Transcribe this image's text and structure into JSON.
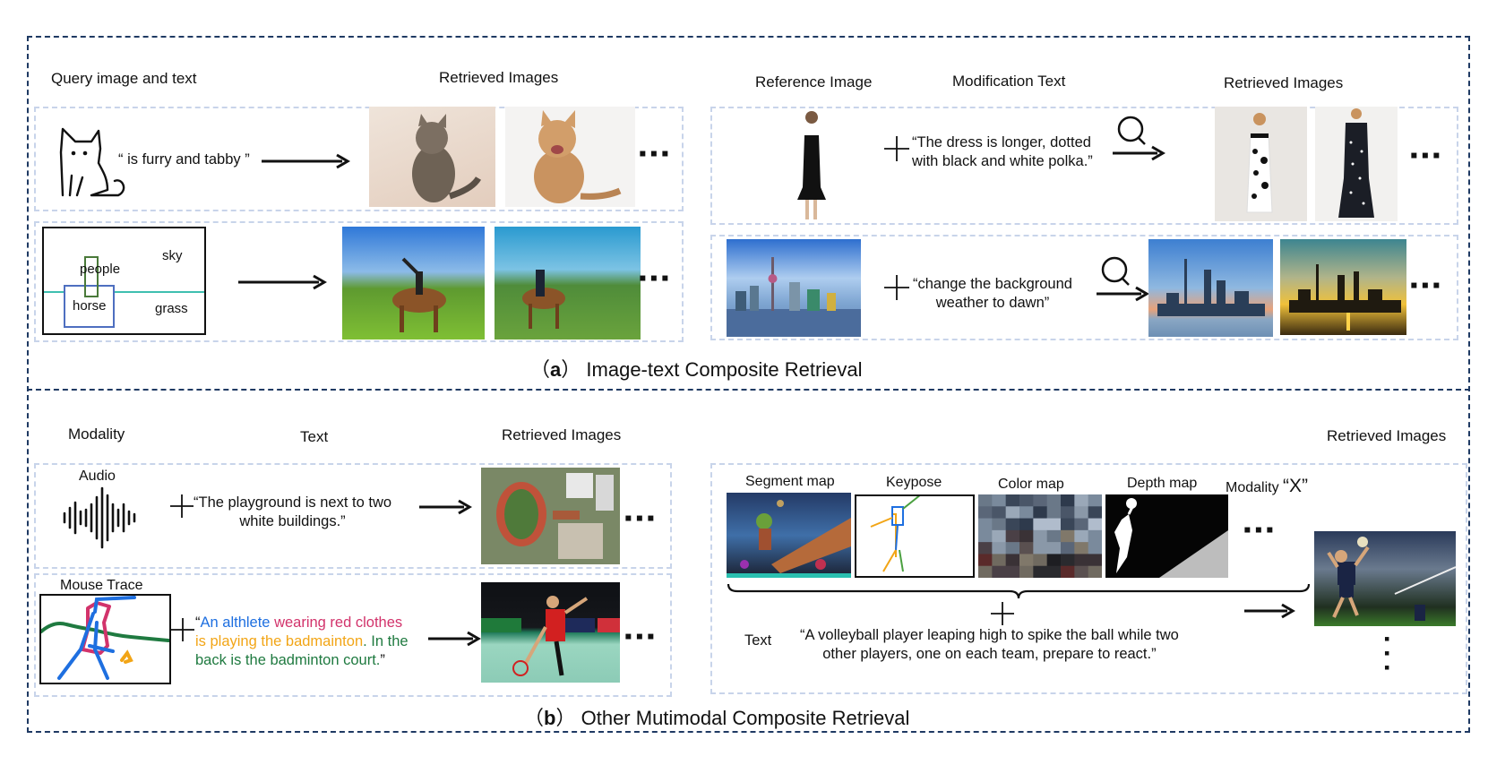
{
  "section_a": {
    "caption_letter": "a",
    "caption_paren_open": "（",
    "caption_paren_close": "）",
    "caption_title": "Image-text Composite Retrieval",
    "left": {
      "header_query": "Query image and text",
      "header_retrieved": "Retrieved Images",
      "row1_text": "“ is furry and tabby ”",
      "row2_labels": {
        "people": "people",
        "sky": "sky",
        "horse": "horse",
        "grass": "grass"
      }
    },
    "right": {
      "header_reference": "Reference Image",
      "header_modification": "Modification Text",
      "header_retrieved": "Retrieved Images",
      "row1_text_line1": "“The dress is longer, dotted",
      "row1_text_line2": "with black and white polka.”",
      "row2_text_line1": "“change the background",
      "row2_text_line2": "weather to dawn”"
    }
  },
  "section_b": {
    "caption_letter": "b",
    "caption_paren_open": "（",
    "caption_paren_close": "）",
    "caption_title": "Other Mutimodal Composite Retrieval",
    "left": {
      "header_modality": "Modality",
      "header_text": "Text",
      "header_retrieved": "Retrieved Images",
      "row1_modality": "Audio",
      "row1_text_line1": "“The playground is next to two",
      "row1_text_line2": "white buildings.”",
      "row2_modality": "Mouse Trace",
      "row2_segments": [
        {
          "text": "“",
          "color": "#111111"
        },
        {
          "text": "An althlete",
          "color": "#1e6fe0"
        },
        {
          "text": " wearing red clothes",
          "color": "#d2336b"
        },
        {
          "text": "is playing the badmainton",
          "color": "#f2a516"
        },
        {
          "text": ". In the",
          "color": "#1f7a40"
        },
        {
          "text": "back is the badminton court.",
          "color": "#1f7a40"
        },
        {
          "text": "”",
          "color": "#111111"
        }
      ]
    },
    "right": {
      "header_retrieved": "Retrieved Images",
      "modalities": [
        "Segment map",
        "Keypose",
        "Color map",
        "Depth map"
      ],
      "modality_x_label": "Modality",
      "modality_x_value": "“X”",
      "text_label": "Text",
      "text_line1": "“A volleyball player leaping high to spike the ball while two",
      "text_line2": "other players, one on each team, prepare to react.”"
    }
  },
  "colors": {
    "outer_border": "#1f3a63",
    "panel_border": "#c8d4ea",
    "mouse_trace_blue": "#1e6fe0",
    "mouse_trace_red": "#d2336b",
    "mouse_trace_orange": "#f2a516",
    "mouse_trace_green": "#1f7a40"
  }
}
